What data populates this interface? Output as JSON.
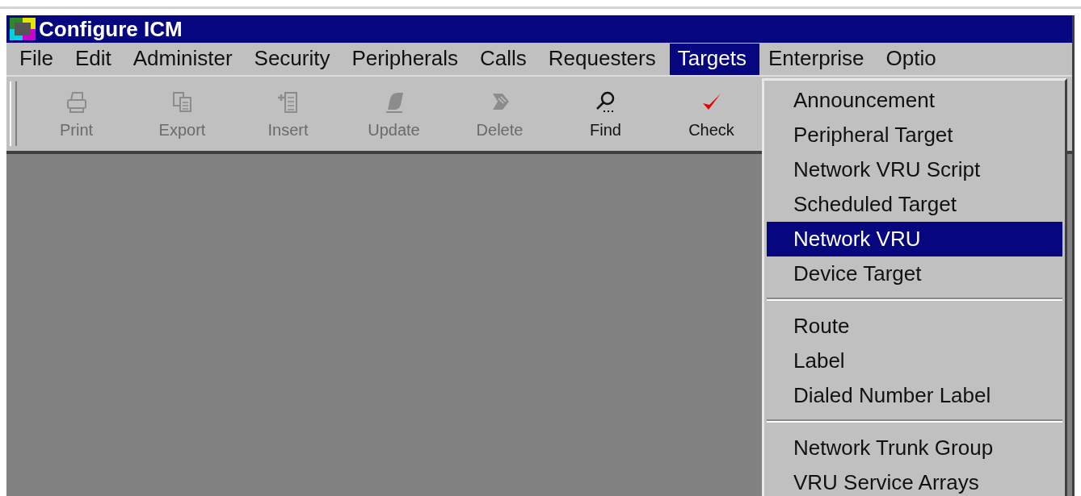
{
  "window": {
    "title": "Configure ICM"
  },
  "menu_bar": [
    {
      "label": "File",
      "selected": false
    },
    {
      "label": "Edit",
      "selected": false
    },
    {
      "label": "Administer",
      "selected": false
    },
    {
      "label": "Security",
      "selected": false
    },
    {
      "label": "Peripherals",
      "selected": false
    },
    {
      "label": "Calls",
      "selected": false
    },
    {
      "label": "Requesters",
      "selected": false
    },
    {
      "label": "Targets",
      "selected": true
    },
    {
      "label": "Enterprise",
      "selected": false
    },
    {
      "label": "Optio",
      "selected": false
    }
  ],
  "toolbar": [
    {
      "label": "Print",
      "kind": "printer",
      "disabled": true
    },
    {
      "label": "Export",
      "kind": "copy",
      "disabled": true
    },
    {
      "label": "Insert",
      "kind": "insert",
      "disabled": true
    },
    {
      "label": "Update",
      "kind": "update",
      "disabled": true
    },
    {
      "label": "Delete",
      "kind": "eraser",
      "disabled": true
    },
    {
      "label": "Find",
      "kind": "magnifier",
      "disabled": false
    },
    {
      "label": "Check",
      "kind": "check",
      "disabled": false
    }
  ],
  "dropdown": [
    {
      "kind": "item",
      "label": "Announcement",
      "selected": false
    },
    {
      "kind": "item",
      "label": "Peripheral Target",
      "selected": false
    },
    {
      "kind": "item",
      "label": "Network VRU Script",
      "selected": false
    },
    {
      "kind": "item",
      "label": "Scheduled Target",
      "selected": false
    },
    {
      "kind": "item",
      "label": "Network VRU",
      "selected": true
    },
    {
      "kind": "item",
      "label": "Device Target",
      "selected": false
    },
    {
      "kind": "separator"
    },
    {
      "kind": "item",
      "label": "Route",
      "selected": false
    },
    {
      "kind": "item",
      "label": "Label",
      "selected": false
    },
    {
      "kind": "item",
      "label": "Dialed Number Label",
      "selected": false
    },
    {
      "kind": "separator"
    },
    {
      "kind": "item",
      "label": "Network Trunk Group",
      "selected": false
    },
    {
      "kind": "item",
      "label": "VRU Service Arrays",
      "selected": false
    }
  ]
}
